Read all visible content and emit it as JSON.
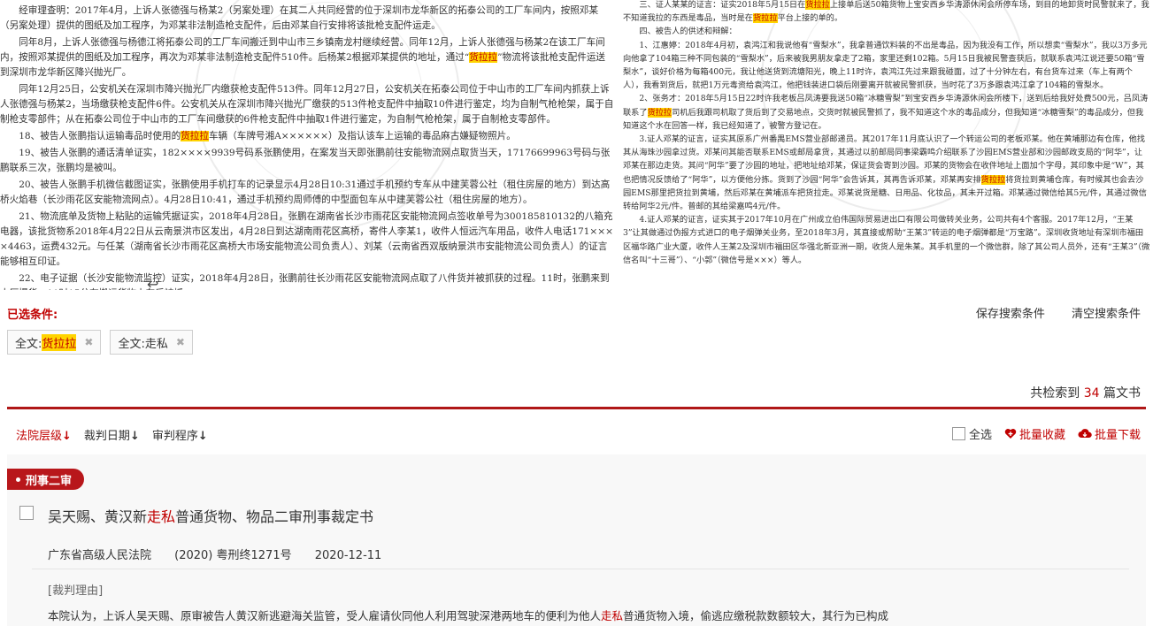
{
  "snippets": {
    "left": [
      "经审理查明：2017年4月，上诉人张德强与杨某2（另案处理）在其二人共同经营的位于深圳市龙华新区的拓泰公司的工厂车间内，按照邓某（另案处理）提供的图纸及加工程序，为邓某非法制造枪支配件，后由邓某自行安排将该批枪支配件运走。",
      "同年8月，上诉人张德强与杨德江将拓泰公司的工厂车间搬迁到中山市三乡镇南龙村继续经营。同年12月，上诉人张德强与杨某2在该工厂车间内，按照邓某提供的图纸及加工程序，再次为邓某非法制造枪支配件510件。后杨某2根据邓某提供的地址，通过“货拉拉”物流将该批枪支配件运送到深圳市龙华新区降兴抛光厂。",
      "同年12月25日，公安机关在深圳市降兴抛光厂内缴获枪支配件513件。同年12月27日，公安机关在拓泰公司位于中山市的工厂车间内抓获上诉人张德强与杨某2，当场缴获枪支配件6件。公安机关从在深圳市降兴抛光厂缴获的513件枪支配件中抽取10件进行鉴定，均为自制气枪枪架，属于自制枪支零部件；从在拓泰公司位于中山市的工厂车间缴获的6件枪支配件中抽取1件进行鉴定，为自制气枪枪架，属于自制枪支零部件。",
      "18、被告人张鹏指认运输毒品时使用的货拉拉车辆（车牌号湘A××××××）及指认该车上运输的毒品麻古嫌疑物照片。",
      "19、被告人张鹏的通话清单证实，182××××9939号码系张鹏使用，在案发当天即张鹏前往安能物流网点取货当天，17176699963号码与张鹏联系三次，张鹏均是被叫。",
      "20、被告人张鹏手机微信截图证实，张鹏使用手机打车的记录显示4月28日10:31通过手机预约专车从中建芙蓉公社（租住房屋的地方）到达高桥火焰巷（长沙雨花区安能物流网点）。4月28日10:41，通过手机预约周师傅的中型面包车从中建芙蓉公社（租住房屋的地方）。",
      "21、物流底单及货物上粘贴的运输凭据证实，2018年4月28日，张鹏在湖南省长沙市雨花区安能物流网点签收单号为300185810132的八箱充电器，该批货物系2018年4月22日从云南景洪市区发出，4月28日到达湖南雨花区高桥，寄件人李某1，收件人恒远汽车用品，收件人电话171××××4463，运费432元。与任某（湖南省长沙市雨花区高桥大市场安能物流公司负责人）、刘某（云南省西双版纳景洪市安能物流公司负责人）的证言能够相互印证。",
      "22、电子证据（长沙安能物流监控）证实，2018年4月28日，张鹏前往长沙雨花区安能物流网点取了八件货并被抓获的过程。11时，张鹏来到大厅提货，11时15分在搬运货物上车后被抓。"
    ],
    "right": [
      "三、证人某某的证言：证实2018年5月15日在货拉拉上接单后送50箱货物上宝安西乡华涛源休闲会所停车场，到目的地卸货时民警就来了，我不知道我拉的东西是毒品，当时是在货拉拉平台上接的单的。",
      "四、被告人的供述和辩解：",
      "1、江惠婷：2018年4月初，袁鸿江和我说他有“雪梨水”，我拿普通饮料装的不出是毒品，因为我没有工作，所以想卖“雪梨水”，我以3万多元向他拿了104箱三种不同包装的“雪梨水”，后来被我男朋友拿走了2箱，家里还剩102箱。5月15日我被民警查获后，就联系袁鸿江说还要50箱“雪梨水”，谈好价格为每箱400元，我让他送货到流塘阳光，晚上11时许，袁鸿江先过来跟我碰面，过了十分钟左右，有台货车过来（车上有两个人），我看到货后，就把1万元毒资给袁鸿江，他把钱装进口袋后刚要离开就被民警抓获，当时花了3万多跟袁鸿江拿了104箱的雪梨水。",
      "2、张务才：2018年5月15日22时许我老板吕凤涛要我送50箱“冰糖雪梨”到宝安西乡华涛源休闲会所楼下，送到后给我好处费500元，吕凤涛联系了货拉拉司机后我跟司机取了货后到了交易地点，交货时就被民警抓了，我不知道这个水的毒品成分，但我知道“冰糖雪梨”的毒品成分，但我知道这个水在回答一样，我已经知道了，被警方登记在。",
      "3.证人邓某的证言，证实其原系广州番禺EMS营业部邮递员。其2017年11月底认识了一个转运公司的老板邓某。他在黄埔那边有仓库，他找其从海珠沙园拿过货。邓某问其能否联系EMS或邮局拿货，其通过以前邮局同事梁霸鸣介绍联系了沙园EMS营业部和沙园邮政支局的“阿华”，让邓某在那边走货。其问“阿华”要了沙园的地址，把地址给邓某，保证货会寄到沙园。邓某的货物会在收件地址上面加个字母，其印象中是“W”，其也把情况反馈给了“阿华”，以方便他分拣。货到了沙园“阿华”会告诉其，其再告诉邓某，邓某再安排货拉拉将货拉到黄埔仓库，有时候其也会去沙园EMS那里把货拉到黄埔，然后邓某在黄埔派车把货拉走。邓某说货是糖、日用品、化妆品，其未开过箱。邓某通过微信给其5元/件，其通过微信转给阿华2元/件。普邮的其给梁嘉鸣4元/件。",
      "4.证人邓某的证言，证实其于2017年10月在广州成立伯伟国际贸易进出口有限公司做转关业务，公司共有4个客服。2017年12月，“王某3”让其做通过伪报方式进口的电子烟弹关业务，至2018年3月，其直接或帮助“王某3”转运的电子烟弹都是“万宝路”。深圳收货地址有深圳市福田区福华路广业大厦，收件人王某2及深圳市福田区华强北新亚洲一期，收货人是朱某。其手机里的一个微信群，除了其公司人员外，还有“王某3”（微信名叫“十三哥”）、“小郭”（微信号是×××）等人。"
    ],
    "highlight_word": "货拉拉",
    "return_symbol": "↩"
  },
  "conditions": {
    "title": "已选条件:",
    "save_label": "保存搜索条件",
    "clear_label": "清空搜索条件",
    "chips": [
      {
        "prefix": "全文: ",
        "term": "货拉拉",
        "highlighted": true,
        "remove": "✖"
      },
      {
        "prefix": "全文: ",
        "term": "走私",
        "highlighted": false,
        "remove": "✖"
      }
    ]
  },
  "results": {
    "count_prefix": "共检索到 ",
    "count": "34",
    "count_suffix": " 篇文书"
  },
  "sort": {
    "court_level": "法院层级",
    "judge_date": "裁判日期",
    "procedure": "审判程序",
    "arrow": "↓"
  },
  "bulk": {
    "select_all": "全选",
    "favorite": "批量收藏",
    "download": "批量下载"
  },
  "card": {
    "tag": "刑事二审",
    "title_pre": "吴天赐、黄汉新",
    "title_hl": "走私",
    "title_post": "普通货物、物品二审刑事裁定书",
    "court": "广东省高级人民法院",
    "case_no": "(2020) 粤刑终1271号",
    "date": "2020-12-11",
    "reason_label": "[裁判理由]",
    "reason_pre": "本院认为，上诉人吴天赐、原审被告人黄汉新逃避海关监管，受人雇请伙同他人利用驾驶深港两地车的便利为他人",
    "reason_hl": "走私",
    "reason_post": "普通货物入境，偷逃应缴税款数额较大，其行为已构成"
  },
  "colors": {
    "accent_red": "#c00000",
    "tag_red": "#b8171b",
    "highlight_yellow": "#ffd400"
  }
}
